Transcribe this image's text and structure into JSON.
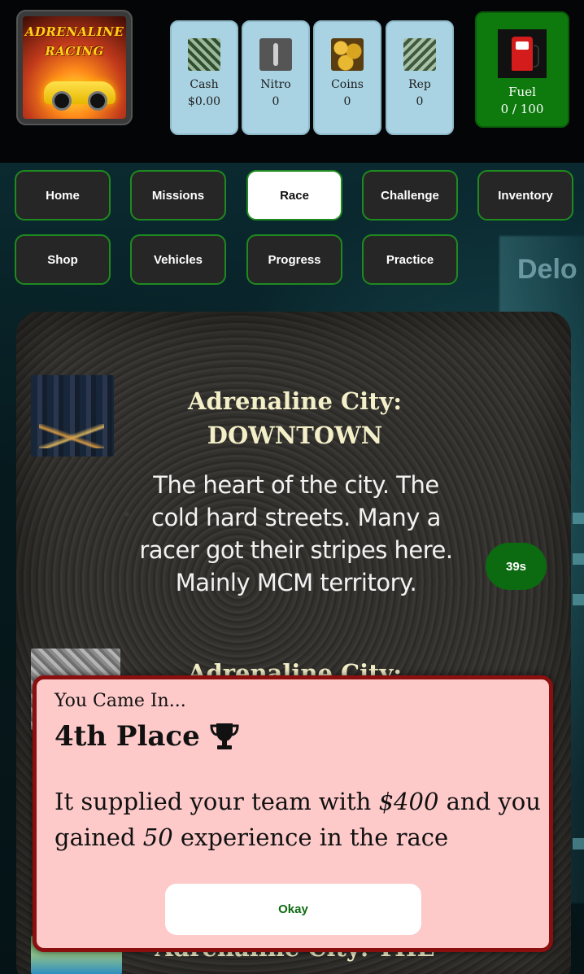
{
  "logo": {
    "line1": "ADRENALINE",
    "line2": "RACING"
  },
  "stats": [
    {
      "label": "Cash",
      "value": "$0.00",
      "icon": "cash-icon"
    },
    {
      "label": "Nitro",
      "value": "0",
      "icon": "nitro-icon"
    },
    {
      "label": "Coins",
      "value": "0",
      "icon": "coins-icon"
    },
    {
      "label": "Rep",
      "value": "0",
      "icon": "rep-icon"
    }
  ],
  "fuel": {
    "label": "Fuel",
    "value": "0 / 100",
    "icon": "fuel-pump-icon",
    "color": "#0e7a0e"
  },
  "nav": {
    "items": [
      "Home",
      "Missions",
      "Race",
      "Challenge",
      "Inventory",
      "Shop",
      "Vehicles",
      "Progress",
      "Practice"
    ],
    "active": "Race"
  },
  "background": {
    "sign_text": "Delo"
  },
  "races": [
    {
      "title": "Adrenaline City: DOWNTOWN",
      "description": "The heart of the city. The cold hard streets. Many a racer got their stripes here. Mainly MCM territory.",
      "timer": "39s"
    },
    {
      "title": "Adrenaline City:"
    },
    {
      "title": "Adrenaline City: THE"
    }
  ],
  "result": {
    "pre": "You Came In...",
    "place": "4th Place",
    "msg_part1": "It supplied your team with ",
    "amount": "$400",
    "msg_part2": " and you gained ",
    "xp": "50",
    "msg_part3": " experience in the race",
    "okay_label": "Okay"
  },
  "colors": {
    "accent_green": "#1f8a1f",
    "modal_bg": "#fdc9c9",
    "modal_border": "#8a0f0f",
    "stat_bg": "#a9d3e3"
  }
}
